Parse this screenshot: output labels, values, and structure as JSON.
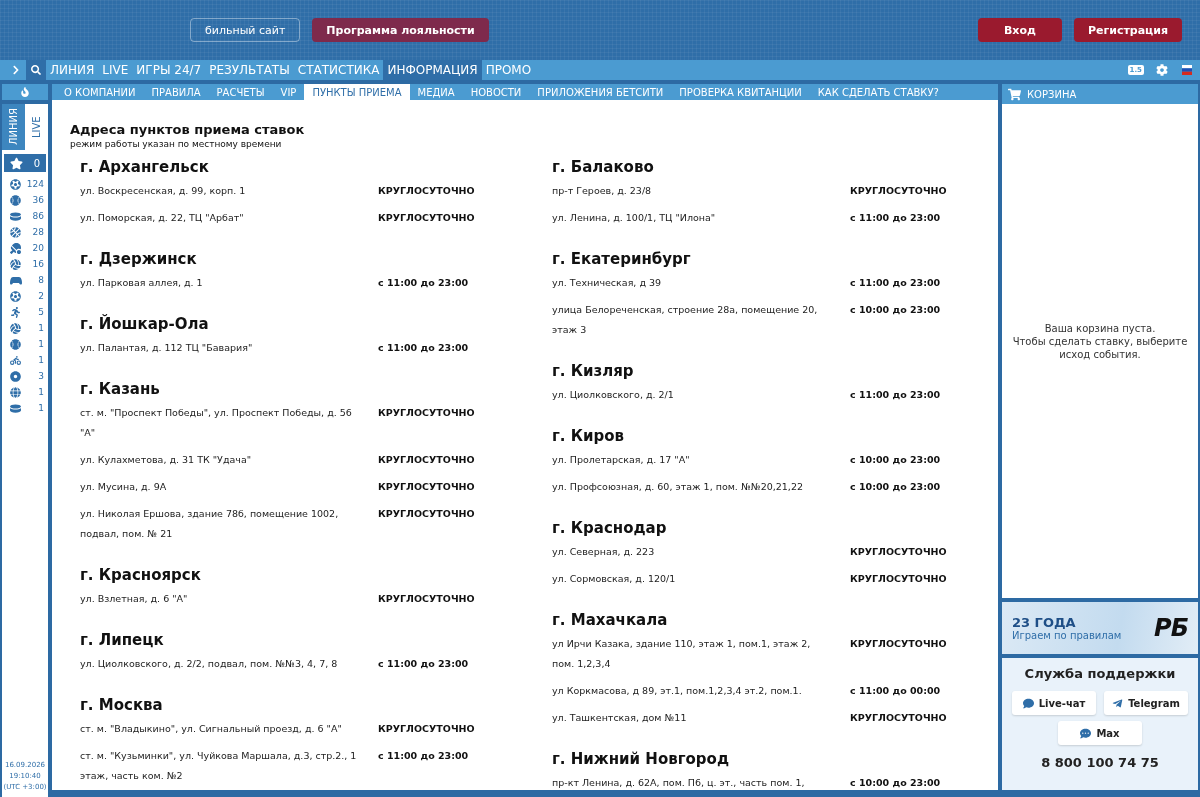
{
  "header": {
    "mobile_button": "бильный сайт",
    "loyalty_button": "Программа лояльности",
    "login_button": "Вход",
    "register_button": "Регистрация"
  },
  "nav": {
    "items": [
      {
        "label": "ЛИНИЯ",
        "selected": false
      },
      {
        "label": "LIVE",
        "selected": false
      },
      {
        "label": "ИГРЫ 24/7",
        "selected": false
      },
      {
        "label": "РЕЗУЛЬТАТЫ",
        "selected": false
      },
      {
        "label": "СТАТИСТИКА",
        "selected": false
      },
      {
        "label": "ИНФОРМАЦИЯ",
        "selected": true
      },
      {
        "label": "ПРОМО",
        "selected": false
      }
    ],
    "odds_format": "1.5"
  },
  "subnav": [
    {
      "label": "О КОМПАНИИ",
      "selected": false
    },
    {
      "label": "ПРАВИЛА",
      "selected": false
    },
    {
      "label": "РАСЧЕТЫ",
      "selected": false
    },
    {
      "label": "VIP",
      "selected": false
    },
    {
      "label": "ПУНКТЫ ПРИЕМА",
      "selected": true
    },
    {
      "label": "МЕДИА",
      "selected": false
    },
    {
      "label": "НОВОСТИ",
      "selected": false
    },
    {
      "label": "ПРИЛОЖЕНИЯ БЕТСИТИ",
      "selected": false
    },
    {
      "label": "ПРОВЕРКА КВИТАНЦИИ",
      "selected": false
    },
    {
      "label": "КАК СДЕЛАТЬ СТАВКУ?",
      "selected": false
    }
  ],
  "sidebar": {
    "tabs": [
      {
        "label": "ЛИНИЯ",
        "selected": false
      },
      {
        "label": "LIVE",
        "selected": true
      }
    ],
    "favorites": "0",
    "sports": [
      {
        "kind": "soccer",
        "count": "124"
      },
      {
        "kind": "tennis",
        "count": "36"
      },
      {
        "kind": "hockey",
        "count": "86"
      },
      {
        "kind": "basketball",
        "count": "28"
      },
      {
        "kind": "tabletennis",
        "count": "20"
      },
      {
        "kind": "volleyball",
        "count": "16"
      },
      {
        "kind": "esports",
        "count": "8"
      },
      {
        "kind": "soccer",
        "count": "2"
      },
      {
        "kind": "athletics",
        "count": "5"
      },
      {
        "kind": "volleyball",
        "count": "1"
      },
      {
        "kind": "baseball",
        "count": "1"
      },
      {
        "kind": "cycling",
        "count": "1"
      },
      {
        "kind": "billiards",
        "count": "3"
      },
      {
        "kind": "globe",
        "count": "1"
      },
      {
        "kind": "hockey",
        "count": "1"
      }
    ],
    "date": "16.09.2026",
    "time": "19:10:40",
    "timezone": "(UTC +3:00)"
  },
  "content": {
    "title": "Адреса пунктов приема ставок",
    "subtitle": "режим работы указан по местному времени",
    "columns": [
      [
        {
          "city": "г. Архангельск",
          "points": [
            {
              "address": "ул. Воскресенская, д. 99, корп. 1",
              "hours": "КРУГЛОСУТОЧНО"
            },
            {
              "address": "ул. Поморская, д. 22, ТЦ \"Арбат\"",
              "hours": "КРУГЛОСУТОЧНО"
            }
          ]
        },
        {
          "city": "г. Дзержинск",
          "points": [
            {
              "address": "ул. Парковая аллея, д. 1",
              "hours": "с 11:00 до 23:00"
            }
          ]
        },
        {
          "city": "г. Йошкар-Ола",
          "points": [
            {
              "address": "ул. Палантая, д. 112 ТЦ \"Бавария\"",
              "hours": "с 11:00 до 23:00"
            }
          ]
        },
        {
          "city": "г. Казань",
          "points": [
            {
              "address": "ст. м. \"Проспект Победы\", ул. Проспект Победы, д. 56 \"А\"",
              "hours": "КРУГЛОСУТОЧНО"
            },
            {
              "address": "ул. Кулахметова, д. 31 ТК \"Удача\"",
              "hours": "КРУГЛОСУТОЧНО"
            },
            {
              "address": "ул. Мусина, д. 9А",
              "hours": "КРУГЛОСУТОЧНО"
            },
            {
              "address": "ул. Николая Ершова, здание 78б, помещение 1002, подвал, пом. № 21",
              "hours": "КРУГЛОСУТОЧНО"
            }
          ]
        },
        {
          "city": "г. Красноярск",
          "points": [
            {
              "address": "ул. Взлетная, д. 6 \"А\"",
              "hours": "КРУГЛОСУТОЧНО"
            }
          ]
        },
        {
          "city": "г. Липецк",
          "points": [
            {
              "address": "ул. Циолковского, д. 2/2, подвал, пом. №№3, 4, 7, 8",
              "hours": "с 11:00 до 23:00"
            }
          ]
        },
        {
          "city": "г. Москва",
          "points": [
            {
              "address": "ст. м. \"Владыкино\", ул. Сигнальный проезд, д. 6 \"А\"",
              "hours": "КРУГЛОСУТОЧНО"
            },
            {
              "address": "ст. м. \"Кузьминки\", ул. Чуйкова Маршала, д.3, стр.2., 1 этаж, часть ком. №2",
              "hours": "с 11:00 до 23:00"
            }
          ]
        }
      ],
      [
        {
          "city": "г. Балаково",
          "points": [
            {
              "address": "пр-т Героев, д. 23/8",
              "hours": "КРУГЛОСУТОЧНО"
            },
            {
              "address": "ул. Ленина, д. 100/1, ТЦ \"Илона\"",
              "hours": "с 11:00 до 23:00"
            }
          ]
        },
        {
          "city": "г. Екатеринбург",
          "points": [
            {
              "address": "ул. Техническая, д 39",
              "hours": "с 11:00 до 23:00"
            },
            {
              "address": "улица Белореченская, строение 28а, помещение 20, этаж 3",
              "hours": "с 10:00 до 23:00"
            }
          ]
        },
        {
          "city": "г. Кизляр",
          "points": [
            {
              "address": "ул. Циолковского, д. 2/1",
              "hours": "с 11:00 до 23:00"
            }
          ]
        },
        {
          "city": "г. Киров",
          "points": [
            {
              "address": "ул. Пролетарская, д. 17 \"А\"",
              "hours": "с 10:00 до 23:00"
            },
            {
              "address": "ул. Профсоюзная, д. 60, этаж 1, пом. №№20,21,22",
              "hours": "с 10:00 до 23:00"
            }
          ]
        },
        {
          "city": "г. Краснодар",
          "points": [
            {
              "address": "ул. Северная, д. 223",
              "hours": "КРУГЛОСУТОЧНО"
            },
            {
              "address": "ул. Сормовская, д. 120/1",
              "hours": "КРУГЛОСУТОЧНО"
            }
          ]
        },
        {
          "city": "г. Махачкала",
          "points": [
            {
              "address": "ул Ирчи Казака, здание 110, этаж 1, пом.1, этаж 2, пом. 1,2,3,4",
              "hours": "КРУГЛОСУТОЧНО"
            },
            {
              "address": "ул Коркмасова, д 89, эт.1, пом.1,2,3,4 эт.2, пом.1.",
              "hours": "с 11:00 до 00:00"
            },
            {
              "address": "ул. Ташкентская, дом №11",
              "hours": "КРУГЛОСУТОЧНО"
            }
          ]
        },
        {
          "city": "г. Нижний Новгород",
          "points": [
            {
              "address": "пр-кт Ленина, д. 62А, пом. П6, ц. эт., часть пом. 1,",
              "hours": "с 10:00 до 23:00"
            }
          ]
        }
      ]
    ]
  },
  "cart": {
    "title": "КОРЗИНА",
    "empty_line1": "Ваша корзина пуста.",
    "empty_line2": "Чтобы сделать ставку, выберите исход события."
  },
  "banner": {
    "title": "23 ГОДА",
    "subtitle": "Играем по правилам",
    "logo": "РБ"
  },
  "support": {
    "title": "Служба поддержки",
    "buttons": [
      {
        "kind": "chat",
        "label": "Live-чат"
      },
      {
        "kind": "telegram",
        "label": "Telegram"
      },
      {
        "kind": "max",
        "label": "Max"
      }
    ],
    "phone": "8 800 100 74 75"
  }
}
